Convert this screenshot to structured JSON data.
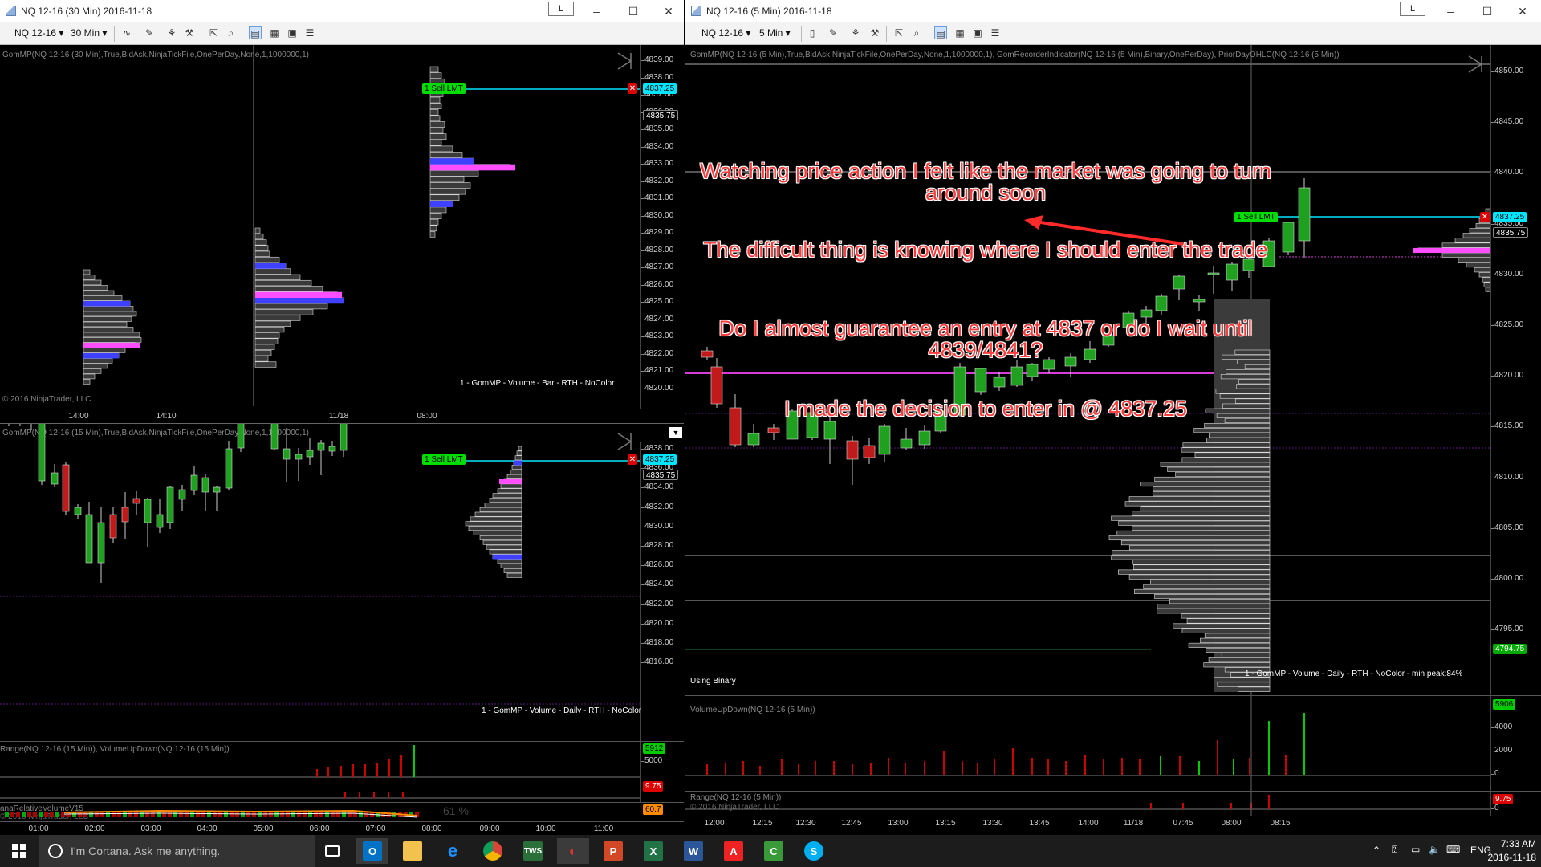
{
  "win_30": {
    "title": "NQ 12-16 (30 Min)  2016-11-18",
    "link": "L",
    "instrument": "NQ 12-16",
    "interval": "30 Min",
    "indicator": "GomMP(NQ 12-16 (30 Min),True,BidAsk,NinjaTickFile,OnePerDay,None,1,1000000,1)",
    "footer": "1 - GomMP  - Volume - Bar - RTH - NoColor",
    "copyright": "© 2016 NinjaTrader, LLC",
    "ticks": [
      "4839.00",
      "4838.00",
      "4837.00",
      "4836.00",
      "4835.00",
      "4834.00",
      "4833.00",
      "4832.00",
      "4831.00",
      "4830.00",
      "4829.00",
      "4828.00",
      "4827.00",
      "4826.00",
      "4825.00",
      "4824.00",
      "4823.00",
      "4822.00",
      "4821.00",
      "4820.00"
    ],
    "last": "4835.75",
    "order_price": "4837.25",
    "order_label": "1   Sell LMT",
    "times": [
      "14:00",
      "14:10",
      "11/18",
      "08:00"
    ]
  },
  "win_15": {
    "indicator": "GomMP(NQ 12-16 (15 Min),True,BidAsk,NinjaTickFile,OnePerDay,None,1,1000000,1)",
    "footer": "1 - GomMP  - Volume - Daily - RTH - NoColor",
    "ticks": [
      "4838.00",
      "4836.00",
      "4834.00",
      "4832.00",
      "4830.00",
      "4828.00",
      "4826.00",
      "4824.00",
      "4822.00",
      "4820.00",
      "4818.00",
      "4816.00"
    ],
    "last": "4835.75",
    "order_price": "4837.25",
    "order_label": "1   Sell LMT",
    "sub1": "Range(NQ 12-16 (15 Min)), VolumeUpDown(NQ 12-16 (15 Min))",
    "sub1_val": "5912",
    "sub1_tick": "5000",
    "sub1_val2": "9.75",
    "sub2": "anaRelativeVolumeV15",
    "sub2_pct": "61 %",
    "sub2_val": "60.7",
    "copyright": "© 2016 NinjaTrader, LLC",
    "times": [
      "01:00",
      "02:00",
      "03:00",
      "04:00",
      "05:00",
      "06:00",
      "07:00",
      "08:00",
      "09:00",
      "10:00",
      "11:00"
    ]
  },
  "win_5": {
    "title": "NQ 12-16 (5 Min)  2016-11-18",
    "link": "L",
    "instrument": "NQ 12-16",
    "interval": "5 Min",
    "indicator": "GomMP(NQ 12-16 (5 Min),True,BidAsk,NinjaTickFile,OnePerDay,None,1,1000000,1), GomRecorderIndicator(NQ 12-16 (5 Min),Binary,OnePerDay), PriorDayOHLC(NQ 12-16 (5 Min))",
    "ticks": [
      "4850.00",
      "4845.00",
      "4840.00",
      "4835.00",
      "4830.00",
      "4825.00",
      "4820.00",
      "4815.00",
      "4810.00",
      "4805.00",
      "4800.00",
      "4795.00"
    ],
    "last": "4835.75",
    "order_price": "4837.25",
    "order_label": "1   Sell LMT",
    "low_flag": "4794.75",
    "using_binary": "Using Binary",
    "footer": "1 - GomMP  - Volume - Daily - RTH - NoColor - min peak:84%",
    "sub1": "VolumeUpDown(NQ 12-16 (5 Min))",
    "sub1_val": "5906",
    "sub1_ticks": [
      "4000",
      "2000",
      "0"
    ],
    "sub2": "Range(NQ 12-16 (5 Min))",
    "sub2_val": "9.75",
    "sub2_tick": "0",
    "copyright": "© 2016 NinjaTrader, LLC",
    "times": [
      "12:00",
      "12:15",
      "12:30",
      "12:45",
      "13:00",
      "13:15",
      "13:30",
      "13:45",
      "14:00",
      "11/18",
      "07:45",
      "08:00",
      "08:15"
    ]
  },
  "annotations": {
    "a1": "Watching price action I felt like the market was going to turn around soon",
    "a2": "The difficult thing is knowing where I should enter the trade",
    "a3": "Do I almost guarantee an entry at 4837 or do I wait until 4839/4841?",
    "a4": "I made the decision to enter in @ 4837.25"
  },
  "taskbar": {
    "cortana": "I'm Cortana. Ask me anything.",
    "lang": "ENG",
    "time": "7:33 AM",
    "date": "2016-11-18",
    "apps": [
      "task-view",
      "outlook",
      "file-explorer",
      "edge",
      "chrome",
      "tws",
      "ninjatrader",
      "powerpoint",
      "excel",
      "word",
      "acrobat",
      "camtasia",
      "skype"
    ]
  },
  "colors": {
    "up": "#1fa01f",
    "down": "#c01a1a",
    "order_line": "#00e5ff",
    "sell_flag": "#00dd00",
    "poc": "#ff4dff",
    "va": "#4040ff"
  }
}
